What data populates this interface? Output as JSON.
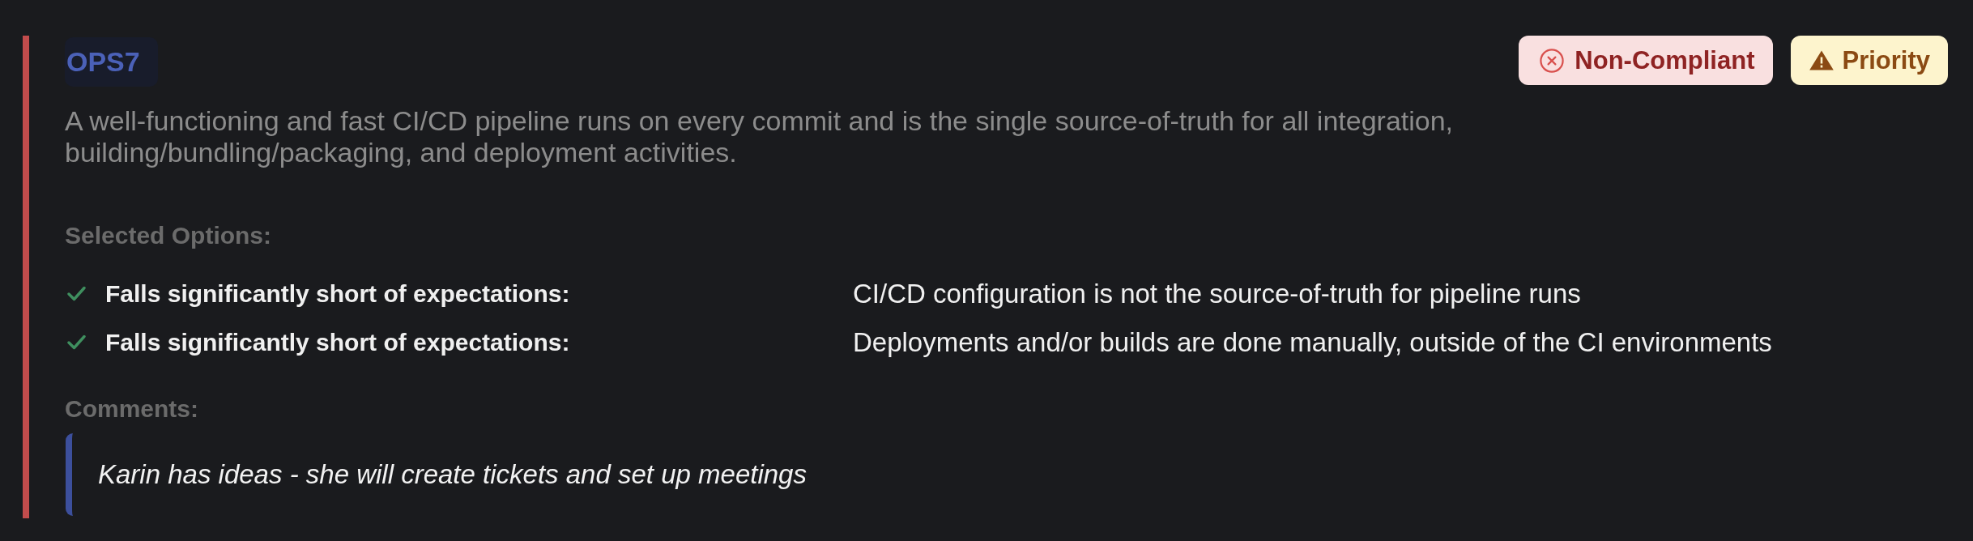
{
  "requirement": {
    "code": "OPS7",
    "description": "A well-functioning and fast CI/CD pipeline runs on every commit and is the single source-of-truth for all integration, building/bundling/packaging, and deployment activities."
  },
  "badges": [
    {
      "kind": "error",
      "label": "Non-Compliant"
    },
    {
      "kind": "warning",
      "label": "Priority"
    }
  ],
  "selected_options": {
    "heading": "Selected Options:",
    "items": [
      {
        "rating": "Falls significantly short of expectations:",
        "detail": "CI/CD configuration is not the source-of-truth for pipeline runs"
      },
      {
        "rating": "Falls significantly short of expectations:",
        "detail": "Deployments and/or builds are done manually, outside of the CI environments"
      }
    ]
  },
  "comments": {
    "heading": "Comments:",
    "items": [
      "Karin has ideas - she will create tickets and set up meetings"
    ]
  }
}
